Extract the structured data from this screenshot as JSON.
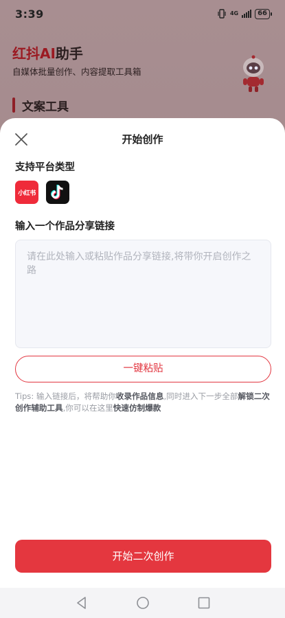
{
  "status_bar": {
    "time": "3:39",
    "network": "4G",
    "battery": "66"
  },
  "background": {
    "app_title_red": "红抖AI",
    "app_title_rest": "助手",
    "app_subtitle": "自媒体批量创作、内容提取工具箱",
    "section_heading": "文案工具"
  },
  "sheet": {
    "title": "开始创作",
    "platform_label": "支持平台类型",
    "platforms": [
      {
        "name": "小红书",
        "icon": "xiaohongshu-icon"
      },
      {
        "name": "",
        "icon": "douyin-icon"
      }
    ],
    "link_label": "输入一个作品分享链接",
    "link_input": {
      "value": "",
      "placeholder": "请在此处输入或粘贴作品分享链接,将带你开启创作之路"
    },
    "paste_button": "一键粘贴",
    "tips": {
      "p1": "Tips: 输入链接后，将帮助你",
      "b1": "收录作品信息",
      "p2": ",同时进入下一步全部",
      "b2": "解锁二次创作辅助工具",
      "p3": ",你可以在这里",
      "b3": "快速仿制爆款"
    },
    "start_button": "开始二次创作"
  },
  "nav_bar": {
    "buttons": [
      "back-icon",
      "home-icon",
      "recents-icon"
    ]
  },
  "colors": {
    "accent": "#e4373f",
    "scrim": "#a3898b",
    "title_red": "#9b1a22"
  }
}
